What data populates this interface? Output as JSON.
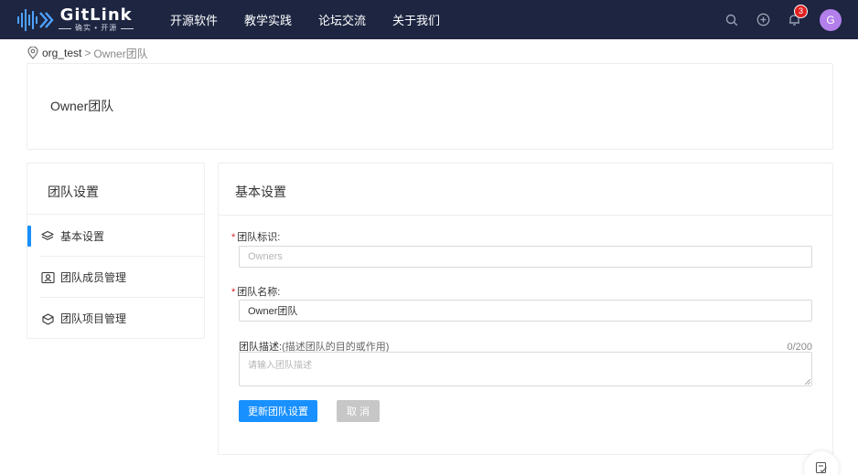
{
  "header": {
    "logo_name": "GitLink",
    "logo_tagline": "确实 • 开源",
    "nav": [
      "开源软件",
      "教学实践",
      "论坛交流",
      "关于我们"
    ],
    "notification_count": "3",
    "avatar_letter": "G"
  },
  "breadcrumb": {
    "org": "org_test",
    "separator": ">",
    "current": "Owner团队"
  },
  "page_title": "Owner团队",
  "sidebar": {
    "title": "团队设置",
    "items": [
      {
        "label": "基本设置",
        "icon": "layers-icon",
        "active": true
      },
      {
        "label": "团队成员管理",
        "icon": "member-card-icon",
        "active": false
      },
      {
        "label": "团队项目管理",
        "icon": "project-box-icon",
        "active": false
      }
    ]
  },
  "main": {
    "title": "基本设置",
    "fields": {
      "identifier_label": "团队标识:",
      "identifier_placeholder": "Owners",
      "name_label": "团队名称:",
      "name_value": "Owner团队",
      "desc_label": "团队描述:",
      "desc_hint": "(描述团队的目的或作用)",
      "desc_placeholder": "请输入团队描述",
      "desc_counter": "0/200"
    },
    "buttons": {
      "submit": "更新团队设置",
      "cancel": "取 消"
    }
  },
  "colors": {
    "header_bg": "#1d2541",
    "primary": "#1890ff",
    "badge": "#e02020",
    "avatar": "#b37feb"
  }
}
